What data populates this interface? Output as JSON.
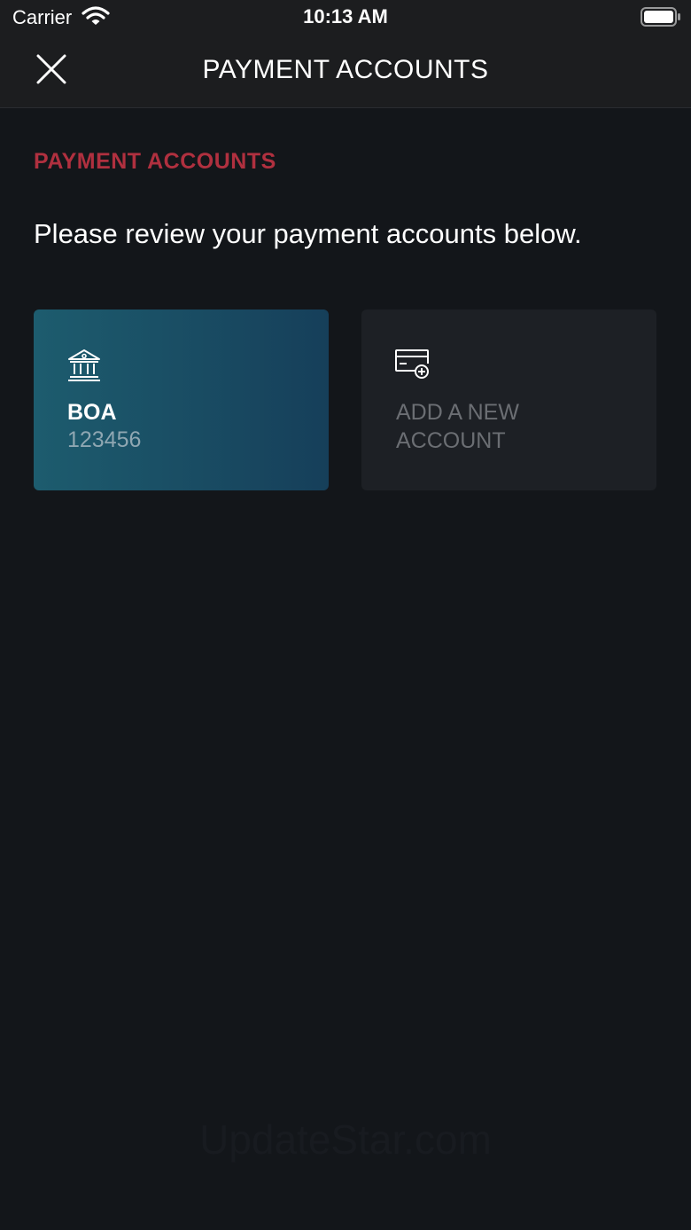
{
  "status_bar": {
    "carrier": "Carrier",
    "time": "10:13 AM",
    "wifi_icon": "wifi-icon",
    "battery_icon": "battery-icon"
  },
  "nav": {
    "title": "PAYMENT ACCOUNTS",
    "close_icon": "close-icon"
  },
  "content": {
    "section_heading": "PAYMENT ACCOUNTS",
    "intro": "Please review your payment accounts below.",
    "accounts": [
      {
        "name": "BOA",
        "number": "123456",
        "icon": "bank-icon"
      }
    ],
    "add_card": {
      "label": "ADD A NEW ACCOUNT",
      "icon": "add-card-icon"
    }
  },
  "watermark": "UpdateStar.com",
  "colors": {
    "background": "#13161a",
    "bar": "#1c1d1f",
    "accent_red": "#b0303f",
    "account_card_start": "#1d5c6e",
    "account_card_end": "#163f5a",
    "add_card": "#1d2025"
  }
}
